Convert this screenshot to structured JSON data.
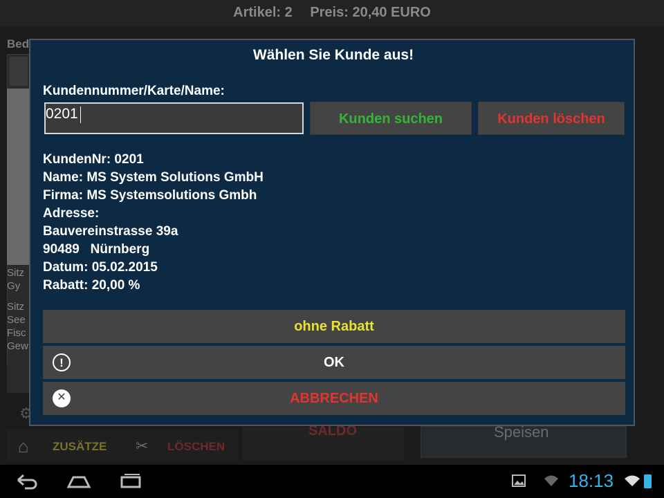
{
  "app": {
    "header": {
      "artikel": "Artikel: 2",
      "preis": "Preis: 20,40 EURO"
    },
    "left_label": "Bed",
    "row1": [
      "Sitz",
      " Gy"
    ],
    "row2": [
      "Sitz",
      " See",
      "Fisc",
      "Gew"
    ],
    "bottom": {
      "zusatze": "ZUSÄTZE",
      "loschen": "LÖSCHEN",
      "saldo": "SALDO",
      "speisen": "Speisen"
    }
  },
  "dialog": {
    "title": "Wählen Sie Kunde aus!",
    "field_label": "Kundennummer/Karte/Name:",
    "input_value": "0201",
    "search_label": "Kunden suchen",
    "clear_label": "Kunden löschen",
    "info": [
      "KundenNr: 0201",
      "Name: MS System Solutions GmbH",
      "Firma: MS Systemsolutions Gmbh",
      "Adresse:",
      "Bauvereinstrasse 39a",
      "90489   Nürnberg",
      "Datum: 05.02.2015",
      "Rabatt: 20,00 %"
    ],
    "no_discount_label": "ohne Rabatt",
    "ok_label": "OK",
    "cancel_label": "ABBRECHEN",
    "colors": {
      "search": "#35b535",
      "clear": "#e4342e",
      "no_discount": "#e8e231",
      "background": "#0d2a45"
    }
  },
  "system": {
    "clock": "18:13"
  }
}
